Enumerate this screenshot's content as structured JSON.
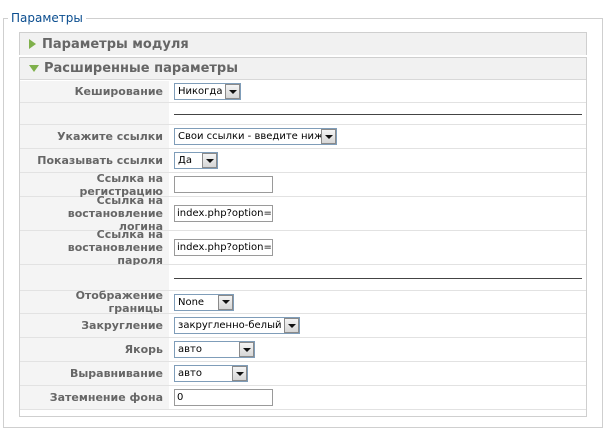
{
  "fieldset": {
    "legend": "Параметры"
  },
  "panels": {
    "module": {
      "title": "Параметры модуля"
    },
    "advanced": {
      "title": "Расширенные параметры"
    }
  },
  "fields": {
    "caching": {
      "label": "Кеширование",
      "value": "Никогда"
    },
    "links_source": {
      "label": "Укажите ссылки",
      "value": "Свои ссылки - введите ниже"
    },
    "show_links": {
      "label": "Показывать ссылки",
      "value": "Да"
    },
    "register_link": {
      "label": "Ссылка на регистрацию",
      "value": ""
    },
    "login_restore": {
      "label": "Ссылка на востановление логина",
      "value": "index.php?option=cc"
    },
    "password_restore": {
      "label": "Ссылка на востановление пароля",
      "value": "index.php?option=cc"
    },
    "border_display": {
      "label": "Отображение границы",
      "value": "None"
    },
    "rounding": {
      "label": "Закругление",
      "value": "закругленно-белый"
    },
    "anchor": {
      "label": "Якорь",
      "value": "авто"
    },
    "alignment": {
      "label": "Выравнивание",
      "value": "авто"
    },
    "bg_dim": {
      "label": "Затемнение фона",
      "value": "0"
    }
  },
  "icons": {
    "collapsed": "triangle-right-icon",
    "expanded": "triangle-down-icon",
    "dropdown": "chevron-down-icon"
  },
  "colors": {
    "legend": "#0a4d8f",
    "toggle": "#7fb04b",
    "label_bg": "#f4f4f4"
  }
}
